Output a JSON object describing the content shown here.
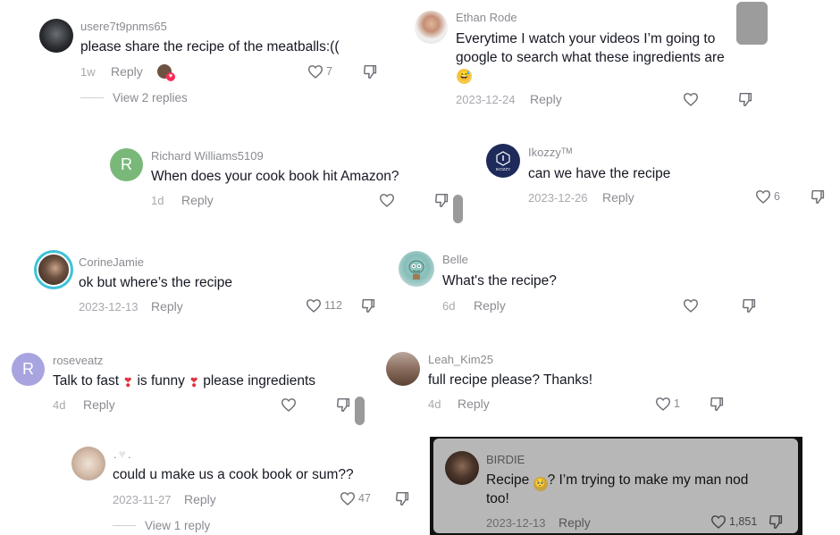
{
  "comments": [
    {
      "user": "usere7t9pnms65",
      "text": "please share the recipe of the meatballs:((",
      "date": "1w",
      "reply": "Reply",
      "likes": "7",
      "view_replies": "View 2 replies"
    },
    {
      "user": "Ethan Rode",
      "text_line1": "Everytime I watch your videos I’m going to",
      "text_line2": "google to search what these ingredients are",
      "date": "2023-12-24",
      "reply": "Reply"
    },
    {
      "user": "Richard Williams5109",
      "text": "When does your cook book hit Amazon?",
      "date": "1d",
      "reply": "Reply",
      "avatar_letter": "R"
    },
    {
      "user": "Ikozzyᵀᴹ",
      "text": "can we have the recipe",
      "date": "2023-12-26",
      "reply": "Reply",
      "likes": "6",
      "avatar_text": "IKOZZY"
    },
    {
      "user": "CorineJamie",
      "text": "ok but where’s the recipe",
      "date": "2023-12-13",
      "reply": "Reply",
      "likes": "112"
    },
    {
      "user": "Belle",
      "text": "What's the recipe?",
      "date": "6d",
      "reply": "Reply"
    },
    {
      "user": "roseveatz",
      "text_a": "Talk to fast",
      "text_b": "is funny",
      "text_c": "please ingredients",
      "date": "4d",
      "reply": "Reply",
      "avatar_letter": "R"
    },
    {
      "user": "Leah_Kim25",
      "text": "full recipe please? Thanks!",
      "date": "4d",
      "reply": "Reply",
      "likes": "1"
    },
    {
      "user": ".",
      "user_suffix": ".",
      "text": "could u make us a cook book or sum??",
      "date": "2023-11-27",
      "reply": "Reply",
      "likes": "47",
      "view_replies": "View 1 reply"
    },
    {
      "user": "BIRDIE",
      "text_a": "Recipe",
      "text_b": "? I’m trying to make my man nod",
      "text_line2": "too!",
      "date": "2023-12-13",
      "reply": "Reply",
      "likes": "1,851"
    }
  ],
  "colors": {
    "accent_cyan": "#3fc2d8",
    "green_avatar": "#7ab87a",
    "purple_avatar": "#a8a4e0",
    "navy_avatar": "#1d2a5a"
  }
}
